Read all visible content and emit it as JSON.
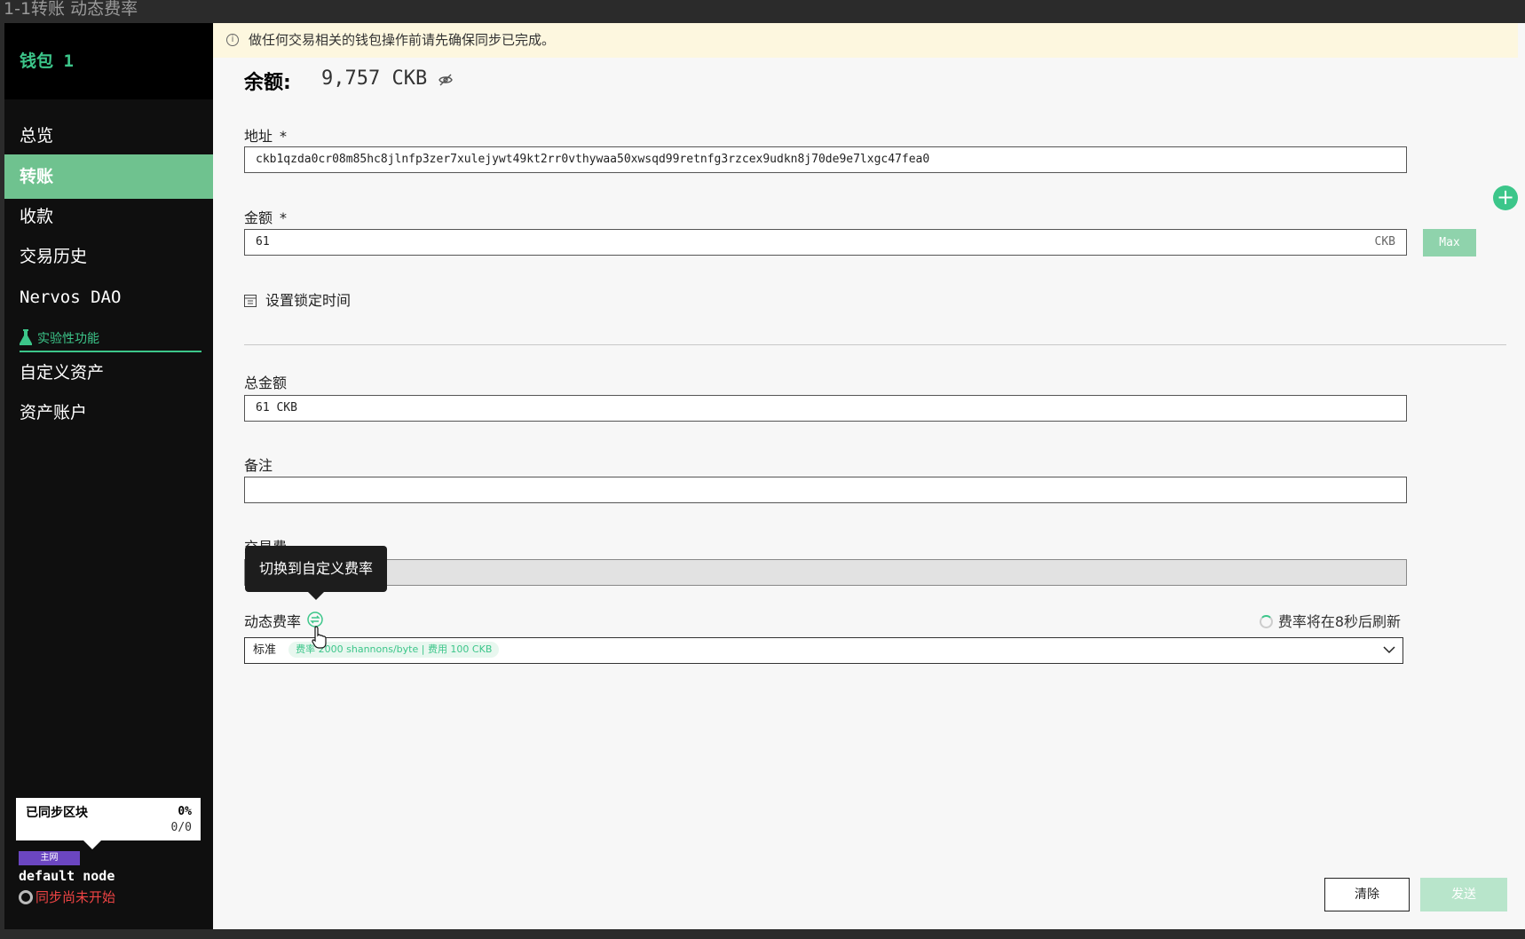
{
  "window": {
    "title": "1-1转账 动态费率"
  },
  "sidebar": {
    "wallet_name": "钱包 1",
    "items": [
      {
        "label": "总览",
        "active": false
      },
      {
        "label": "转账",
        "active": true
      },
      {
        "label": "收款",
        "active": false
      },
      {
        "label": "交易历史",
        "active": false
      },
      {
        "label": "Nervos DAO",
        "active": false
      }
    ],
    "experimental_label": "实验性功能",
    "experimental_items": [
      {
        "label": "自定义资产"
      },
      {
        "label": "资产账户"
      }
    ],
    "sync": {
      "title": "已同步区块",
      "percent": "0%",
      "blocks": "0/0",
      "network_badge": "主网",
      "node_name": "default node",
      "status": "同步尚未开始"
    }
  },
  "main": {
    "notice": "做任何交易相关的钱包操作前请先确保同步已完成。",
    "balance_label": "余额:",
    "balance_value": "9,757 CKB",
    "address": {
      "label": "地址",
      "required_mark": "*",
      "value": "ckb1qzda0cr08m85hc8jlnfp3zer7xulejywt49kt2rr0vthywaa50xwsqd99retnfg3rzcex9udkn8j70de9e7lxgc47fea0"
    },
    "amount": {
      "label": "金额",
      "required_mark": "*",
      "value": "61",
      "unit": "CKB",
      "max_button": "Max"
    },
    "lock_time_label": "设置锁定时间",
    "total": {
      "label": "总金额",
      "value": "61 CKB"
    },
    "note": {
      "label": "备注",
      "value": ""
    },
    "fee": {
      "label": "交易费",
      "value": ""
    },
    "rate": {
      "label": "动态费率",
      "tooltip": "切换到自定义费率",
      "refresh_text": "费率将在8秒后刷新",
      "selected": "标准",
      "detail": "费率 2000 shannons/byte | 费用 100 CKB"
    },
    "buttons": {
      "clear": "清除",
      "send": "发送"
    }
  },
  "colors": {
    "accent": "#3cc68a",
    "active_nav": "#6fc28f",
    "error": "#ef4444",
    "badge": "#6b46c1"
  },
  "icons": [
    "info-icon",
    "eye-off-icon",
    "plus-icon",
    "calendar-icon",
    "swap-icon",
    "spinner-icon",
    "chevron-down-icon",
    "flask-icon",
    "pointer-cursor-icon",
    "node-status-icon"
  ]
}
